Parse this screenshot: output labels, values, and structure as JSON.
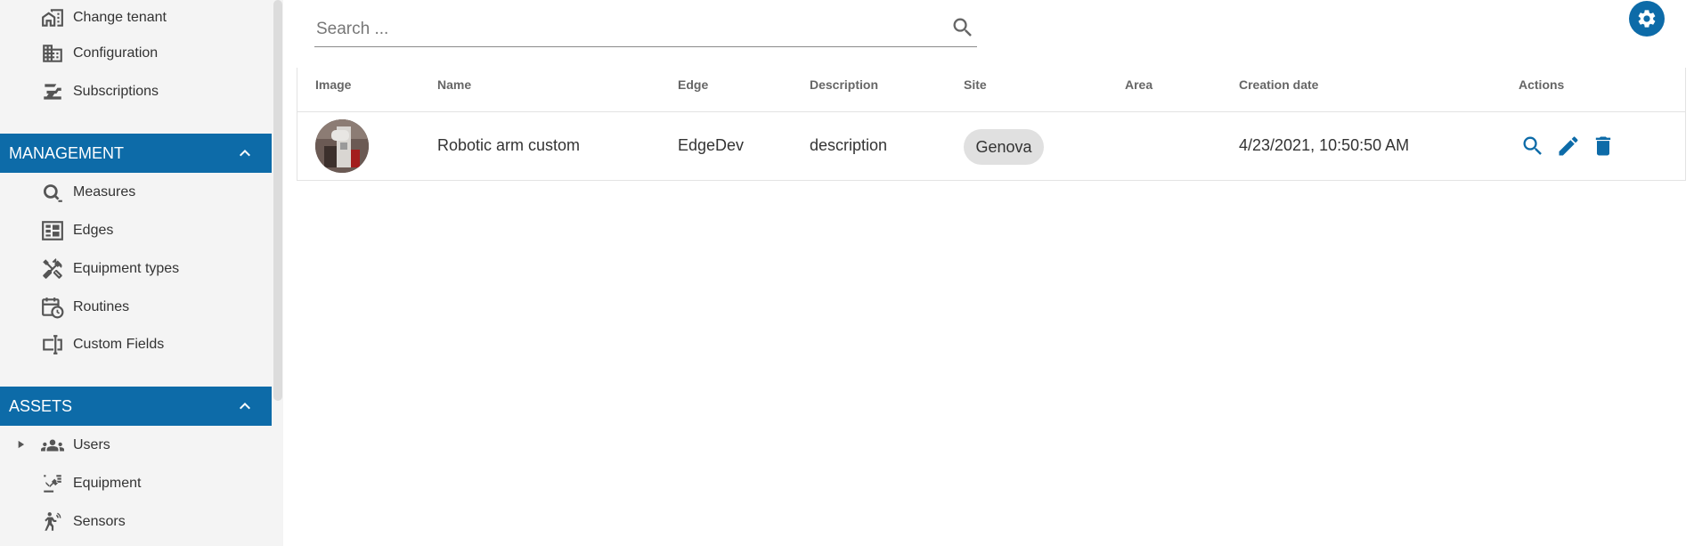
{
  "sidebar": {
    "top_items": [
      {
        "label": "Change tenant",
        "icon": "change-tenant-icon"
      },
      {
        "label": "Configuration",
        "icon": "configuration-icon"
      },
      {
        "label": "Subscriptions",
        "icon": "subscriptions-icon"
      }
    ],
    "management": {
      "title": "MANAGEMENT",
      "items": [
        {
          "label": "Measures",
          "icon": "measures-icon"
        },
        {
          "label": "Edges",
          "icon": "edges-icon"
        },
        {
          "label": "Equipment types",
          "icon": "equipment-types-icon"
        },
        {
          "label": "Routines",
          "icon": "routines-icon"
        },
        {
          "label": "Custom Fields",
          "icon": "custom-fields-icon"
        }
      ]
    },
    "assets": {
      "title": "ASSETS",
      "items": [
        {
          "label": "Users",
          "icon": "users-icon"
        },
        {
          "label": "Equipment",
          "icon": "equipment-icon"
        },
        {
          "label": "Sensors",
          "icon": "sensors-icon"
        }
      ]
    }
  },
  "search": {
    "placeholder": "Search ...",
    "value": ""
  },
  "table": {
    "headers": [
      "Image",
      "Name",
      "Edge",
      "Description",
      "Site",
      "Area",
      "Creation date",
      "Actions"
    ],
    "rows": [
      {
        "name": "Robotic arm custom",
        "edge": "EdgeDev",
        "description": "description",
        "site": "Genova",
        "area": "",
        "creation_date": "4/23/2021, 10:50:50 AM",
        "actions": [
          "view-icon",
          "edit-icon",
          "delete-icon"
        ]
      }
    ]
  },
  "colors": {
    "accent": "#0d6ba8",
    "sidebar_bg": "#f4f4f4",
    "chip_bg": "#e0e0e0"
  }
}
